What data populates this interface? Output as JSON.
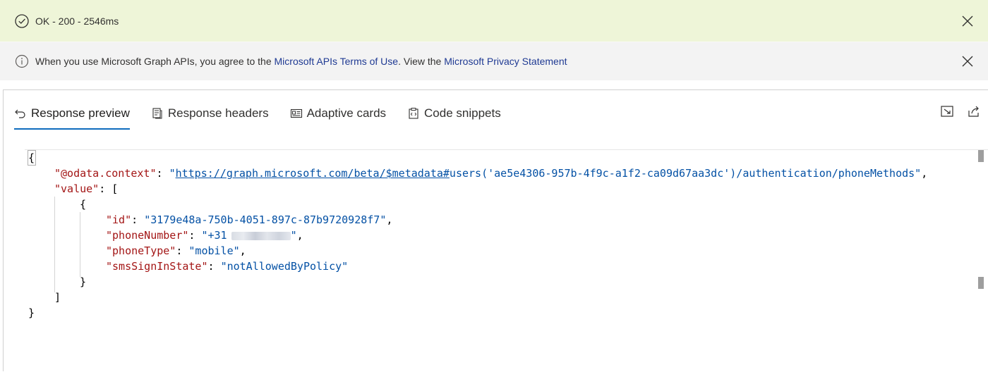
{
  "status_banner": {
    "text": "OK - 200 - 2546ms",
    "icon": "check-circle-icon",
    "color": "#eef5d8"
  },
  "info_banner": {
    "prefix": "When you use Microsoft Graph APIs, you agree to the ",
    "terms_link": "Microsoft APIs Terms of Use",
    "middle": ". View the ",
    "privacy_link": "Microsoft Privacy Statement",
    "icon": "info-icon"
  },
  "tabs": [
    {
      "label": "Response preview",
      "icon": "undo-arrow-icon",
      "active": true
    },
    {
      "label": "Response headers",
      "icon": "document-icon",
      "active": false
    },
    {
      "label": "Adaptive cards",
      "icon": "card-icon",
      "active": false
    },
    {
      "label": "Code snippets",
      "icon": "clipboard-code-icon",
      "active": false
    }
  ],
  "actions": [
    {
      "name": "expand-icon"
    },
    {
      "name": "share-icon"
    }
  ],
  "json": {
    "open_brace": "{",
    "close_brace": "}",
    "odata_key": "\"@odata.context\"",
    "odata_url": "https://graph.microsoft.com/beta/$metadata#",
    "odata_rest": "users('ae5e4306-957b-4f9c-a1f2-ca09d67aa3dc')/authentication/phoneMethods\"",
    "value_key": "\"value\"",
    "open_bracket": "[",
    "close_bracket": "]",
    "item_open": "{",
    "item_close": "}",
    "id_key": "\"id\"",
    "id_value": "\"3179e48a-750b-4051-897c-87b9720928f7\"",
    "phone_key": "\"phoneNumber\"",
    "phone_value_prefix": "\"+31",
    "phone_value_suffix": "\"",
    "type_key": "\"phoneType\"",
    "type_value": "\"mobile\"",
    "sms_key": "\"smsSignInState\"",
    "sms_value": "\"notAllowedByPolicy\""
  },
  "colors": {
    "accent": "#0f6cbd",
    "json_key": "#a31515",
    "json_string": "#0451a5"
  }
}
